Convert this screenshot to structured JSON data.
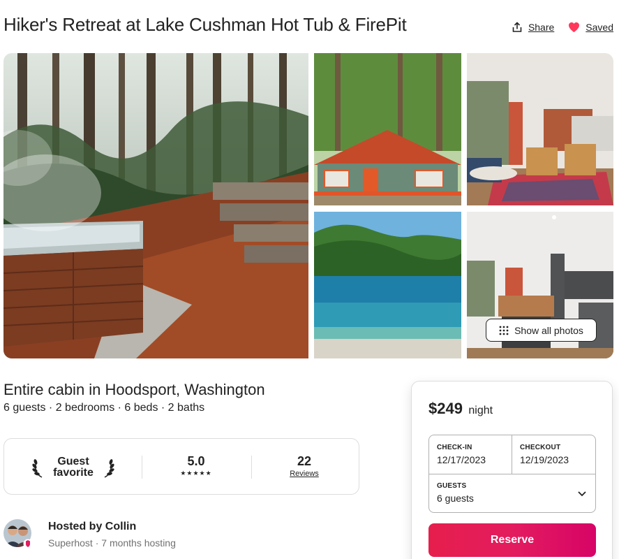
{
  "listing": {
    "title": "Hiker's Retreat at Lake Cushman Hot Tub & FirePit",
    "share_label": "Share",
    "saved_label": "Saved",
    "show_all_photos_label": "Show all photos",
    "subtitle": "Entire cabin in Hoodsport, Washington",
    "details": "6 guests · 2 bedrooms · 6 beds · 2 baths"
  },
  "guest_favorite": {
    "label_line1": "Guest",
    "label_line2": "favorite",
    "rating": "5.0",
    "stars": "★★★★★",
    "reviews_count": "22",
    "reviews_label": "Reviews"
  },
  "host": {
    "name": "Hosted by Collin",
    "meta": "Superhost · 7 months hosting"
  },
  "booking": {
    "price": "$249",
    "price_unit": "night",
    "checkin_label": "CHECK-IN",
    "checkin_value": "12/17/2023",
    "checkout_label": "CHECKOUT",
    "checkout_value": "12/19/2023",
    "guests_label": "GUESTS",
    "guests_value": "6 guests",
    "reserve_label": "Reserve"
  },
  "icons": {
    "share": "share-icon",
    "saved": "heart-icon",
    "grid": "grid-icon",
    "laurel": "laurel-icon",
    "chevron": "chevron-down-icon",
    "superhost_badge": "superhost-badge-icon"
  },
  "colors": {
    "accent": "#E31C5F",
    "heart": "#FF385C",
    "text": "#222222",
    "muted": "#717171",
    "border": "#DDDDDD"
  }
}
